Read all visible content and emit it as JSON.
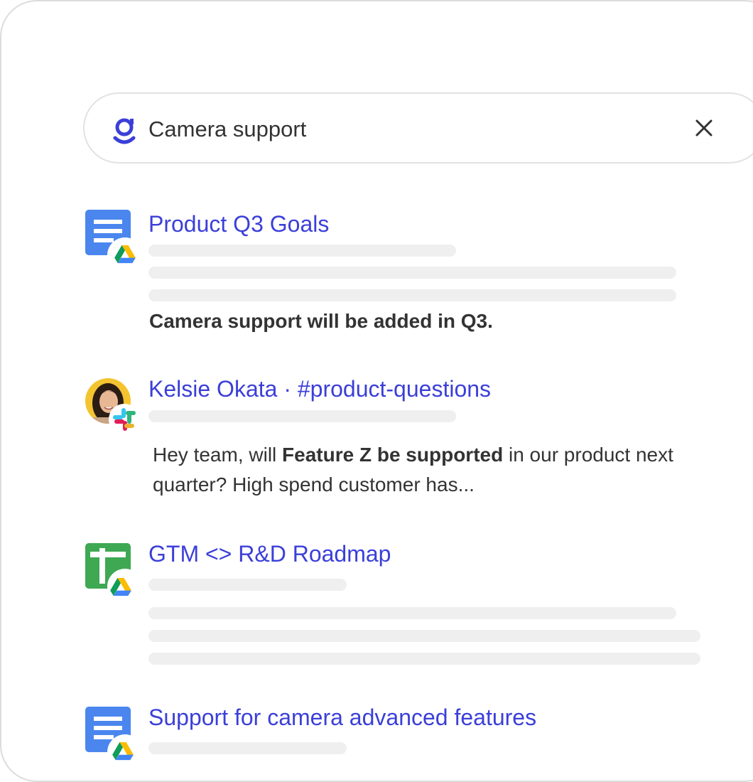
{
  "search": {
    "query": "Camera support",
    "logo_icon": "glean-logo-icon",
    "clear_icon": "close-icon"
  },
  "colors": {
    "accent": "#3b3fd8",
    "docs_blue": "#4b86ee",
    "sheets_green": "#3ea853",
    "skeleton": "#efefef"
  },
  "results": [
    {
      "title": "Product Q3 Goals",
      "app_icon": "google-docs-icon",
      "source_icon": "google-drive-icon",
      "snippet": "Camera support will be added in Q3."
    },
    {
      "title": "Kelsie Okata · #product-questions",
      "app_icon": "avatar",
      "source_icon": "slack-icon",
      "snippet_pre": "Hey team, will ",
      "snippet_bold": "Feature Z be supported",
      "snippet_post": " in our product next quarter? High spend customer has..."
    },
    {
      "title": "GTM <> R&D Roadmap",
      "app_icon": "google-sheets-icon",
      "source_icon": "google-drive-icon"
    },
    {
      "title": "Support for camera advanced features",
      "app_icon": "google-docs-icon",
      "source_icon": "google-drive-icon"
    }
  ]
}
